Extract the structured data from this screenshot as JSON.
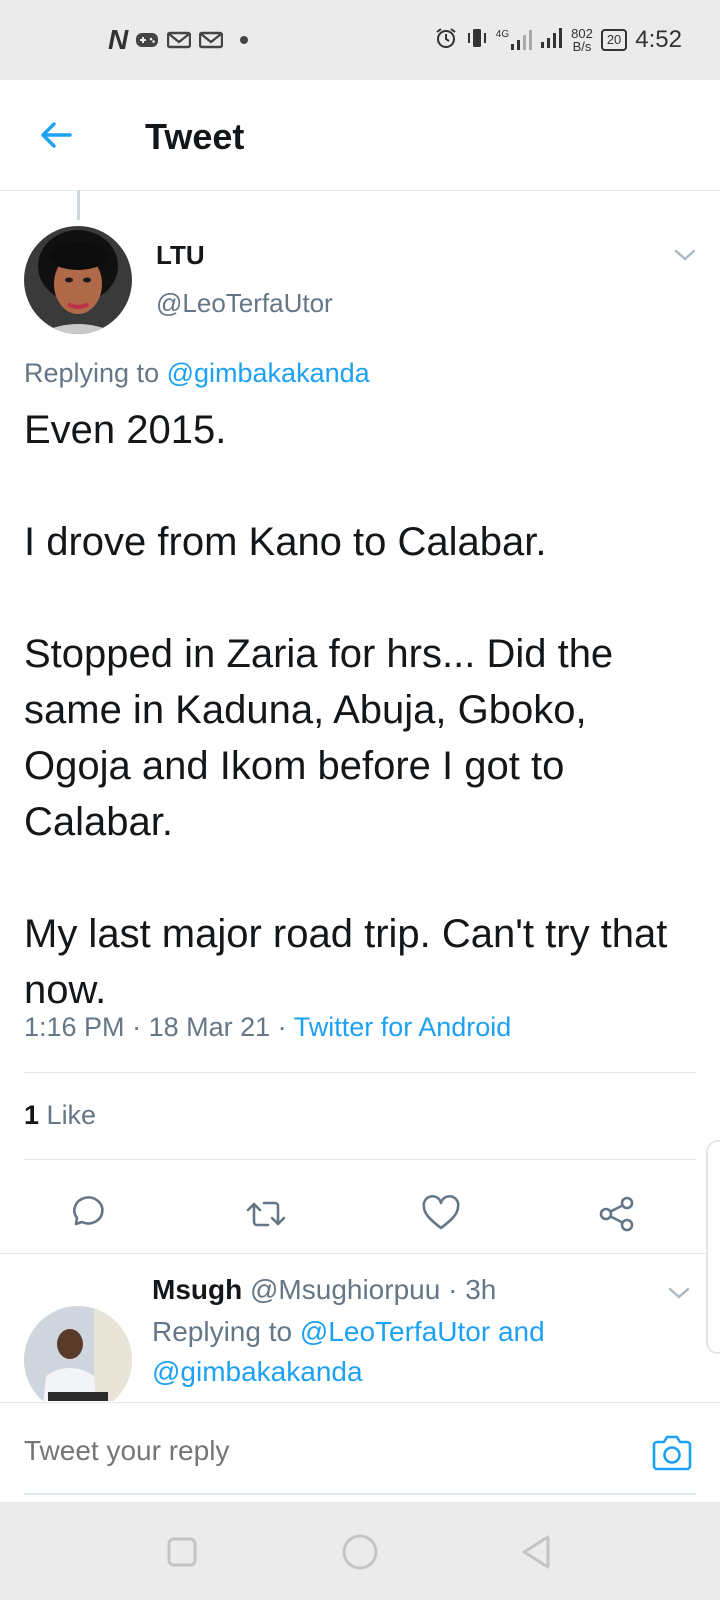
{
  "status_bar": {
    "network_speed_value": "802",
    "network_speed_unit": "B/s",
    "network_type": "4G",
    "battery": "20",
    "time": "4:52"
  },
  "header": {
    "title": "Tweet"
  },
  "tweet": {
    "author_name": "LTU",
    "author_handle": "@LeoTerfaUtor",
    "replying_prefix": "Replying to",
    "replying_to": "@gimbakakanda",
    "paragraphs": [
      "Even 2015.",
      "I drove from Kano to Calabar.",
      "Stopped in Zaria for hrs... Did the same in Kaduna, Abuja, Gboko, Ogoja and Ikom before I got to Calabar.",
      "My last major road trip. Can't try that now."
    ],
    "time": "1:16 PM",
    "date": "18 Mar 21",
    "source": "Twitter for Android",
    "like_count": "1",
    "like_label": "Like"
  },
  "reply": {
    "author_name": "Msugh",
    "author_handle": "@Msughiorpuu",
    "age": "3h",
    "replying_prefix": "Replying to",
    "replying_to_1": "@LeoTerfaUtor",
    "replying_joiner": "and",
    "replying_to_2": "@gimbakakanda"
  },
  "composer": {
    "placeholder": "Tweet your reply"
  },
  "colors": {
    "accent": "#1da1f2",
    "secondary_text": "#657786",
    "divider": "#e1e8ed",
    "system_bar": "#ebebeb"
  },
  "icons": {
    "back": "arrow-left-icon",
    "caret": "chevron-down-icon",
    "reply": "comment-icon",
    "retweet": "retweet-icon",
    "like": "heart-icon",
    "share": "share-icon",
    "camera": "camera-icon"
  }
}
